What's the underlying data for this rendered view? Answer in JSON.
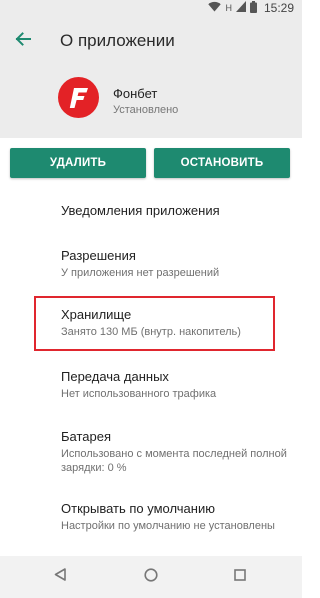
{
  "status_bar": {
    "time": "15:29",
    "network": "H",
    "icons": [
      "wifi-icon",
      "signal-icon",
      "battery-icon"
    ]
  },
  "toolbar": {
    "title": "О приложении",
    "back_icon": "arrow-back-icon"
  },
  "app": {
    "name": "Фонбет",
    "status": "Установлено",
    "icon_letter": "F",
    "icon_color": "#e32226"
  },
  "actions": {
    "delete_label": "УДАЛИТЬ",
    "stop_label": "ОСТАНОВИТЬ",
    "accent_color": "#1e8a70"
  },
  "settings": [
    {
      "title": "Уведомления приложения",
      "subtitle": ""
    },
    {
      "title": "Разрешения",
      "subtitle": "У приложения нет разрешений"
    },
    {
      "title": "Хранилище",
      "subtitle": "Занято 130 МБ (внутр. накопитель)",
      "highlighted": true
    },
    {
      "title": "Передача данных",
      "subtitle": "Нет использованного трафика"
    },
    {
      "title": "Батарея",
      "subtitle": "Использовано с момента последней полной зарядки: 0 %"
    },
    {
      "title": "Открывать по умолчанию",
      "subtitle": "Настройки по умолчанию не установлены"
    }
  ],
  "nav_bar": {
    "buttons": [
      "back-triangle-icon",
      "home-circle-icon",
      "recents-square-icon"
    ]
  },
  "highlight_color": "#e0262e"
}
